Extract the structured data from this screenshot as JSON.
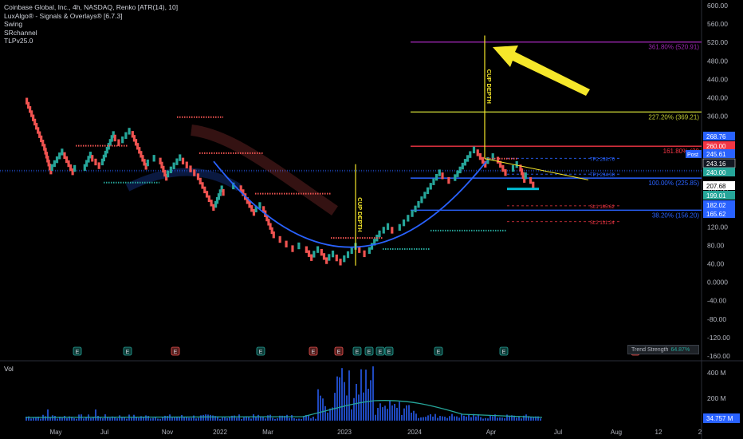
{
  "header": {
    "title": "Coinbase Global, Inc., 4h, NASDAQ, Renko [ATR(14), 10]",
    "indicators": [
      "LuxAlgo® - Signals & Overlays® [6.7.3]",
      "Swing",
      "SRchannel",
      "TLPv25.0"
    ]
  },
  "volume_pane": {
    "label": "Vol",
    "last_value": "34.757 M"
  },
  "trend_strength": {
    "label": "Trend Strength",
    "value": "64.87%"
  },
  "colors": {
    "up": "#26a69a",
    "down": "#ef5350",
    "cup_curve": "#2962ff",
    "fib_361": "#9c27b0",
    "fib_227": "#c0ca33",
    "fib_161": "#f23645",
    "fib_100": "#2962ff",
    "arrow": "#f5e72a"
  },
  "chart_data": {
    "type": "renko",
    "title": "Coinbase Global, Inc., 4h, NASDAQ, Renko [ATR(14), 10]",
    "price_axis": {
      "ticks": [
        "600.00",
        "560.00",
        "520.00",
        "480.00",
        "440.00",
        "400.00",
        "360.00",
        "320.00",
        "280.00",
        "240.00",
        "200.00",
        "160.00",
        "120.00",
        "80.00",
        "40.00",
        "0.0000",
        "-40.00",
        "-80.00",
        "-120.00",
        "-160.00"
      ],
      "ylim": [
        -165,
        608
      ]
    },
    "time_axis": [
      "May",
      "Jul",
      "Nov",
      "2022",
      "Mar",
      "2023",
      "2024",
      "Apr",
      "Jul",
      "Aug",
      "12",
      "2"
    ],
    "price_labels": [
      {
        "text": "268.76",
        "value": 268.76,
        "color": "#2962ff"
      },
      {
        "text": "260.00",
        "value": 260.0,
        "color": "#f23645"
      },
      {
        "text": "245.61",
        "value": 245.61,
        "color": "#2962ff"
      },
      {
        "text": "243.16",
        "value": 243.16,
        "color": "#131722"
      },
      {
        "text": "240.00",
        "value": 240.0,
        "color": "#26a69a"
      },
      {
        "text": "207.68",
        "value": 207.68,
        "color": "#ffffff"
      },
      {
        "text": "199.01",
        "value": 199.01,
        "color": "#26a69a"
      },
      {
        "text": "182.02",
        "value": 182.02,
        "color": "#2962ff"
      },
      {
        "text": "165.62",
        "value": 165.62,
        "color": "#2962ff"
      }
    ],
    "post_badge": "Post",
    "fib_levels": [
      {
        "label": "361.80% (520.91)",
        "value": 520.91,
        "color": "#9c27b0"
      },
      {
        "label": "227.20% (369.21)",
        "value": 369.21,
        "color": "#c0ca33"
      },
      {
        "label": "161.80% (29",
        "value": 295.0,
        "color": "#f23645"
      },
      {
        "label": "100.00% (225.85)",
        "value": 225.85,
        "color": "#2962ff"
      },
      {
        "label": "38.20% (156.20)",
        "value": 156.2,
        "color": "#2962ff"
      }
    ],
    "targets": [
      {
        "label": "TP2 268.76",
        "value": 268.76,
        "color": "#2962ff"
      },
      {
        "label": "TP1 234.38",
        "value": 234.38,
        "color": "#2962ff"
      },
      {
        "label": "SL1 165.62",
        "value": 165.62,
        "color": "#f23645"
      },
      {
        "label": "SL2 131.24",
        "value": 131.24,
        "color": "#f23645"
      }
    ],
    "annotations": [
      "CUP DEPTH",
      "CUP DEPTH"
    ],
    "renko_path": [
      [
        0,
        400
      ],
      [
        14,
        300
      ],
      [
        20,
        240
      ],
      [
        30,
        282
      ],
      [
        38,
        238
      ],
      [
        46,
        240
      ],
      [
        52,
        276
      ],
      [
        60,
        252
      ],
      [
        70,
        320
      ],
      [
        76,
        300
      ],
      [
        84,
        328
      ],
      [
        96,
        250
      ],
      [
        106,
        270
      ],
      [
        112,
        226
      ],
      [
        124,
        270
      ],
      [
        136,
        236
      ],
      [
        150,
        160
      ],
      [
        156,
        202
      ],
      [
        164,
        200
      ],
      [
        170,
        210
      ],
      [
        182,
        150
      ],
      [
        188,
        165
      ],
      [
        196,
        110
      ],
      [
        206,
        90
      ],
      [
        216,
        70
      ],
      [
        222,
        78
      ],
      [
        228,
        52
      ],
      [
        234,
        72
      ],
      [
        240,
        45
      ],
      [
        246,
        60
      ],
      [
        252,
        42
      ],
      [
        264,
        78
      ],
      [
        272,
        60
      ],
      [
        280,
        96
      ],
      [
        290,
        120
      ],
      [
        296,
        110
      ],
      [
        306,
        140
      ],
      [
        316,
        180
      ],
      [
        330,
        238
      ],
      [
        340,
        218
      ],
      [
        352,
        268
      ],
      [
        358,
        288
      ],
      [
        366,
        255
      ],
      [
        374,
        272
      ],
      [
        380,
        245
      ],
      [
        386,
        238
      ],
      [
        392,
        255
      ],
      [
        396,
        222
      ],
      [
        400,
        228
      ],
      [
        404,
        208
      ]
    ],
    "earnings_markers": [
      "E",
      "E",
      "E",
      "E",
      "E",
      "E",
      "E",
      "E",
      "E",
      "E",
      "E",
      "E"
    ],
    "volume": {
      "ylim": [
        0,
        450
      ],
      "ticks": [
        "400 M",
        "200 M"
      ]
    }
  }
}
